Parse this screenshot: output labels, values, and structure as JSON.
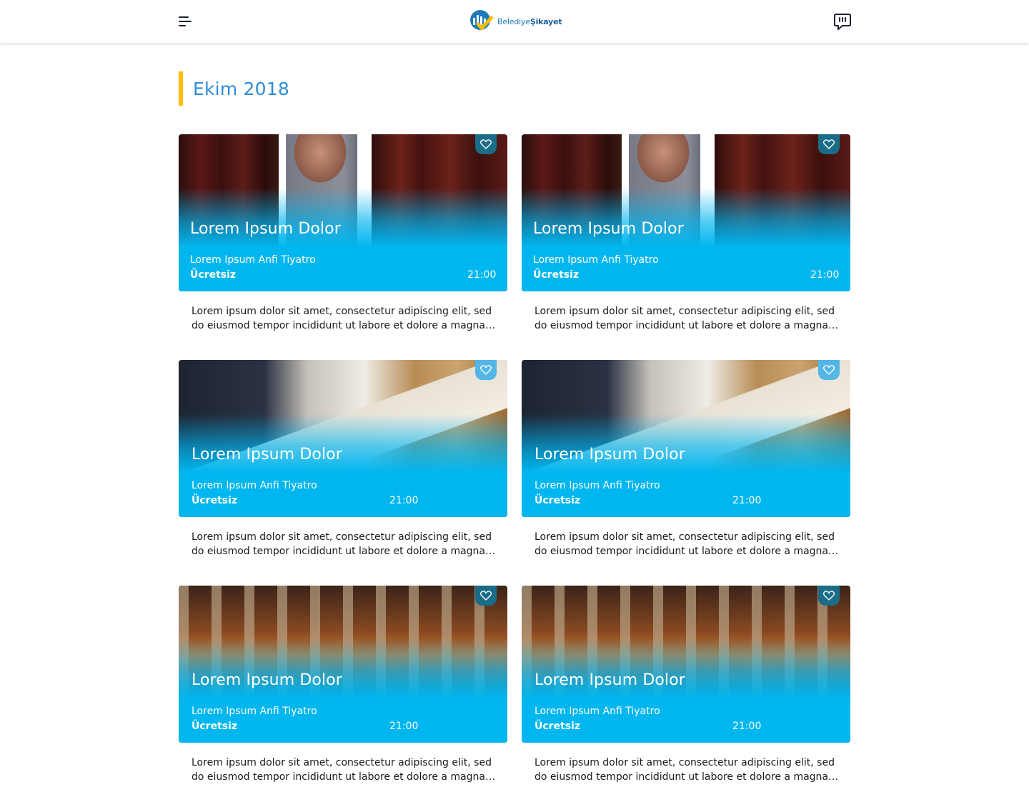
{
  "header": {
    "logo_text_regular": "Belediye",
    "logo_text_bold": "Şikayet",
    "menu_icon": "hamburger-menu-icon",
    "chat_icon": "chat-bubble-icon"
  },
  "section": {
    "title": "Ekim 2018",
    "accent_color": "#ffbd00",
    "title_color": "#2e8dd8"
  },
  "theme": {
    "card_blue": "#00b6ef",
    "fav_dark": "#1b6c86",
    "fav_light": "#53b6e6"
  },
  "cards": [
    {
      "title": "Lorem Ipsum Dolor",
      "venue": "Lorem Ipsum Anfi Tiyatro",
      "price": "Ücretsiz",
      "time": "21:00",
      "description": "Lorem ipsum dolor sit amet, consectetur adipiscing elit, sed do eiusmod tempor incididunt ut labore et dolore a magna…",
      "image": "theater-performer-photo",
      "fav_icon": "heart-icon"
    },
    {
      "title": "Lorem Ipsum Dolor",
      "venue": "Lorem Ipsum Anfi Tiyatro",
      "price": "Ücretsiz",
      "time": "21:00",
      "description": "Lorem ipsum dolor sit amet, consectetur adipiscing elit, sed do eiusmod tempor incididunt ut labore et dolore a magna…",
      "image": "theater-performer-photo",
      "fav_icon": "heart-icon"
    },
    {
      "title": "Lorem Ipsum Dolor",
      "venue": "Lorem Ipsum Anfi Tiyatro",
      "price": "Ücretsiz",
      "time": "21:00",
      "description": "Lorem ipsum dolor sit amet, consectetur adipiscing elit, sed do eiusmod tempor incididunt ut labore et dolore a magna…",
      "image": "children-classroom-photo",
      "fav_icon": "heart-icon"
    },
    {
      "title": "Lorem Ipsum Dolor",
      "venue": "Lorem Ipsum Anfi Tiyatro",
      "price": "Ücretsiz",
      "time": "21:00",
      "description": "Lorem ipsum dolor sit amet, consectetur adipiscing elit, sed do eiusmod tempor incididunt ut labore et dolore a magna…",
      "image": "children-classroom-photo",
      "fav_icon": "heart-icon"
    },
    {
      "title": "Lorem Ipsum Dolor",
      "venue": "Lorem Ipsum Anfi Tiyatro",
      "price": "Ücretsiz",
      "time": "21:00",
      "description": "Lorem ipsum dolor sit amet, consectetur adipiscing elit, sed do eiusmod tempor incididunt ut labore et dolore a magna…",
      "image": "cistern-columns-photo",
      "fav_icon": "heart-icon"
    },
    {
      "title": "Lorem Ipsum Dolor",
      "venue": "Lorem Ipsum Anfi Tiyatro",
      "price": "Ücretsiz",
      "time": "21:00",
      "description": "Lorem ipsum dolor sit amet, consectetur adipiscing elit, sed do eiusmod tempor incididunt ut labore et dolore a magna…",
      "image": "cistern-columns-photo",
      "fav_icon": "heart-icon"
    }
  ]
}
